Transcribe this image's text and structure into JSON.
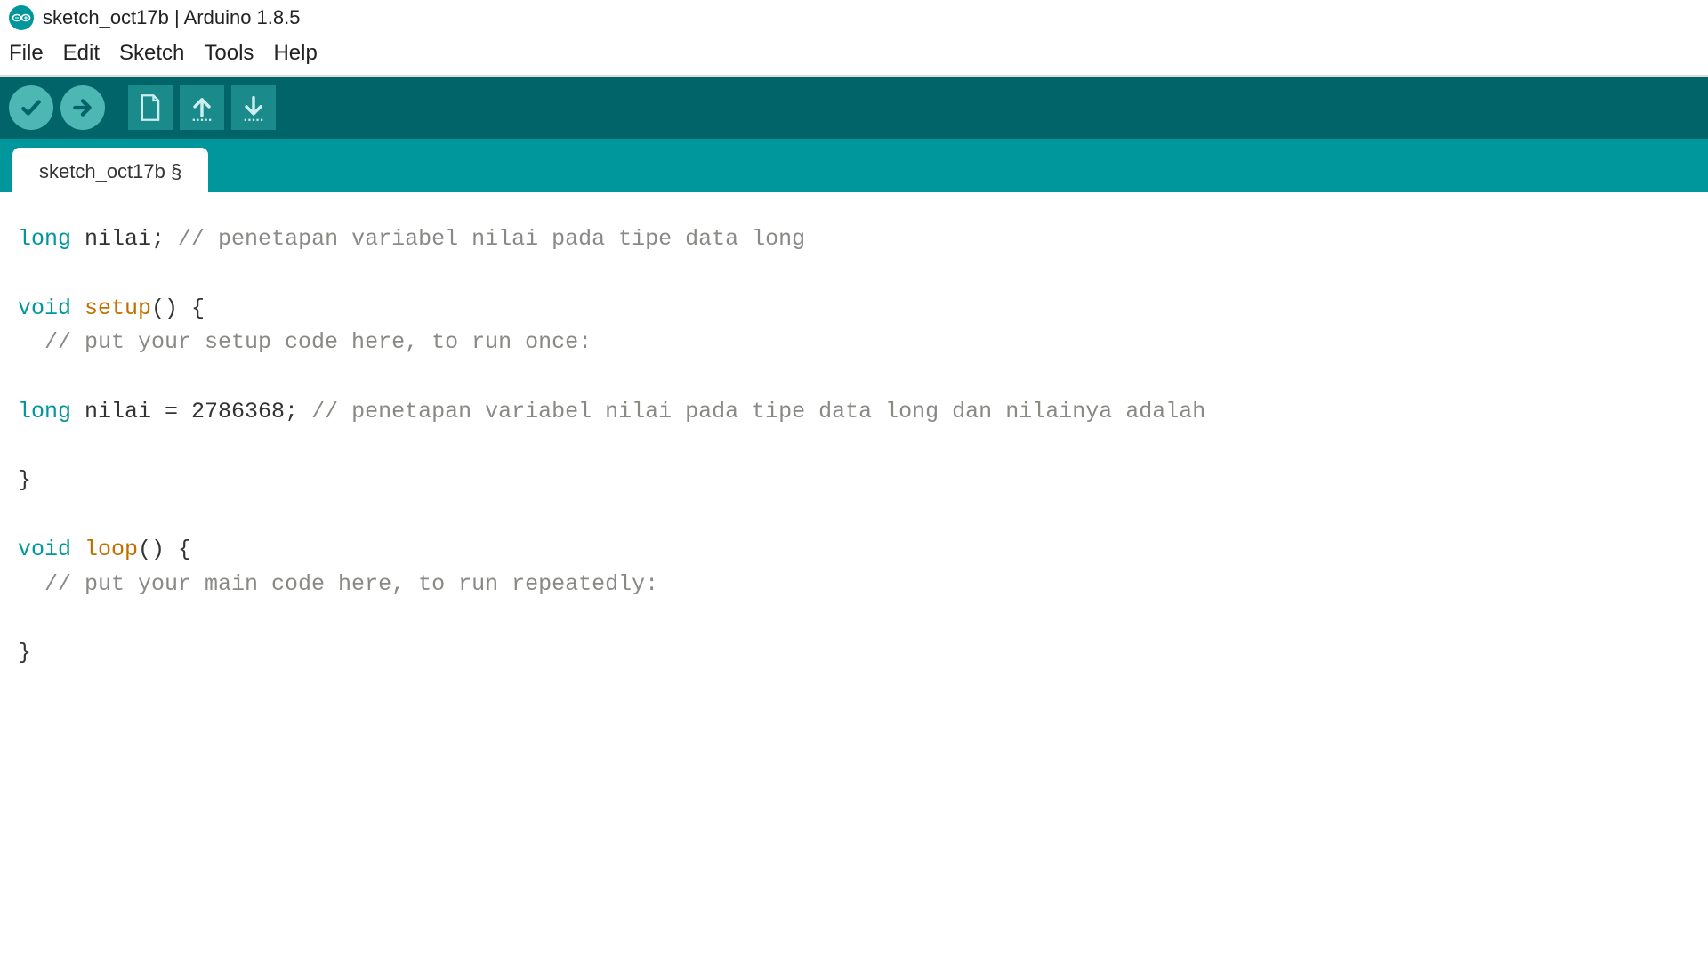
{
  "titlebar": {
    "title": "sketch_oct17b | Arduino 1.8.5"
  },
  "menu": {
    "file": "File",
    "edit": "Edit",
    "sketch": "Sketch",
    "tools": "Tools",
    "help": "Help"
  },
  "tabs": {
    "active": "sketch_oct17b §"
  },
  "code": {
    "l1": {
      "kw": "long",
      "rest": " nilai; ",
      "cm": "// penetapan variabel nilai pada tipe data long"
    },
    "l3": {
      "kw": "void",
      "sp": " ",
      "fn": "setup",
      "rest": "() {"
    },
    "l4": {
      "cm": "  // put your setup code here, to run once:"
    },
    "l6": {
      "kw": "long",
      "rest": " nilai = 2786368; ",
      "cm": "// penetapan variabel nilai pada tipe data long dan nilainya adalah"
    },
    "l8": {
      "rest": "}"
    },
    "l10": {
      "kw": "void",
      "sp": " ",
      "fn": "loop",
      "rest": "() {"
    },
    "l11": {
      "cm": "  // put your main code here, to run repeatedly:"
    },
    "l13": {
      "rest": "}"
    }
  }
}
